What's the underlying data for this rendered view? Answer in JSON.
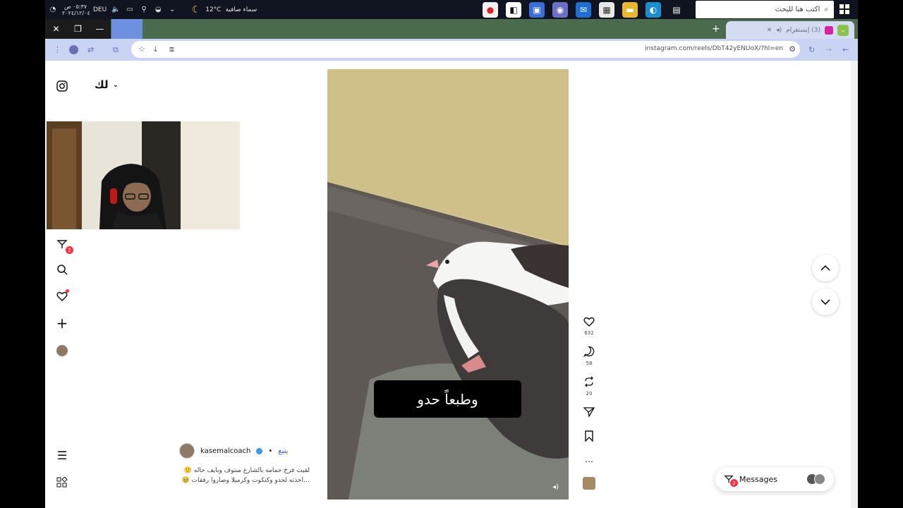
{
  "taskbar": {
    "time": "٠٥:٣٧ ص",
    "date": "٢٠٢٤/١٢/٠٤",
    "language": "DEU",
    "temperature": "12°C",
    "weather": "سماء صافية",
    "search_placeholder": "اكتب هنا للبحث"
  },
  "browser": {
    "tab_title": "(3) إنستغرام",
    "url": "instagram.com/reels/DbT42yENUoX/?hl=en"
  },
  "instagram": {
    "for_you": "لك",
    "messages_badge": "2",
    "messages_label": "Messages"
  },
  "reel": {
    "caption": "وطبعاً حدو",
    "likes": "632",
    "comments": "58",
    "reposts": "20",
    "more": "…",
    "author": "kasemalcoach",
    "follow": "يتبع",
    "description_line1": "لقيت فرخ حمامة بالشارع منتوف وبايف حاله 🙂",
    "description_line2": "…اخذته لحدو وكنكوت وكرميلا وصاروا رفقات 🥹"
  },
  "colors": {
    "accent": "#3897f0",
    "badge": "#ff3040",
    "tab_strip": "#4a6b4e",
    "toolbar": "#c9d3f3"
  }
}
